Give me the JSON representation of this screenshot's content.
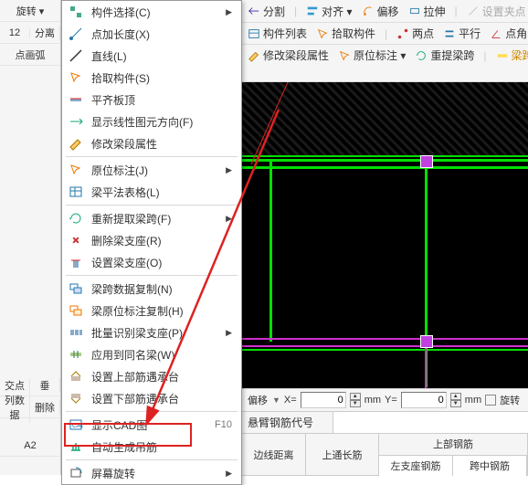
{
  "leftstrip": {
    "rotate_label": "旋转 ▾",
    "row2_left": "12",
    "row2_right": "分离",
    "row3": "点画弧",
    "cross_label": "交点",
    "vert_label": "垂",
    "tab_data": "列数据",
    "tab_delete": "删除",
    "a2": "A2"
  },
  "topbar": {
    "row1": {
      "split": "分割",
      "align": "对齐 ▾",
      "cloud": "偏移",
      "stretch": "拉伸",
      "set_grip": "设置夹点"
    },
    "row2": {
      "component_list": "构件列表",
      "pick": "拾取构件",
      "two_point": "两点",
      "parallel": "平行",
      "point_angle": "点角"
    },
    "row3": {
      "modify_span": "修改梁段属性",
      "inplace_label": "原位标注 ▾",
      "relabel_span": "重提梁跨",
      "span_tail": "梁跨"
    }
  },
  "menu": {
    "items": [
      {
        "label": "构件选择(C)",
        "arrow": true
      },
      {
        "label": "点加长度(X)"
      },
      {
        "label": "直线(L)"
      },
      {
        "label": "拾取构件(S)"
      },
      {
        "label": "平齐板顶"
      },
      {
        "label": "显示线性图元方向(F)"
      },
      {
        "label": "修改梁段属性"
      },
      {
        "sep": true
      },
      {
        "label": "原位标注(J)",
        "arrow": true
      },
      {
        "label": "梁平法表格(L)"
      },
      {
        "sep": true
      },
      {
        "label": "重新提取梁跨(F)",
        "arrow": true
      },
      {
        "label": "删除梁支座(R)"
      },
      {
        "label": "设置梁支座(O)"
      },
      {
        "sep": true
      },
      {
        "label": "梁跨数据复制(N)"
      },
      {
        "label": "梁原位标注复制(H)"
      },
      {
        "label": "批量识别梁支座(P)",
        "arrow": true
      },
      {
        "label": "应用到同名梁(W)"
      },
      {
        "label": "设置上部筋遇承台"
      },
      {
        "label": "设置下部筋遇承台"
      },
      {
        "sep": true
      },
      {
        "label": "显示CAD图",
        "shortcut": "F10"
      },
      {
        "label": "自动生成吊筋"
      },
      {
        "sep": true
      },
      {
        "label": "屏幕旋转",
        "arrow": true
      }
    ]
  },
  "status": {
    "offset": "偏移",
    "x_label": "X=",
    "x_value": "0",
    "mm": "mm",
    "y_label": "Y=",
    "y_value": "0",
    "rotate": "旋转"
  },
  "bottom": {
    "hanger_label": "悬臂钢筋代号",
    "edge_dist": "边线距离",
    "top_long": "上通长筋",
    "top_rebar": "上部钢筋",
    "left_support": "左支座钢筋",
    "mid_span": "跨中钢筋"
  },
  "colors": {
    "green": "#00e000",
    "magenta": "#d030d0",
    "red": "#d22"
  }
}
